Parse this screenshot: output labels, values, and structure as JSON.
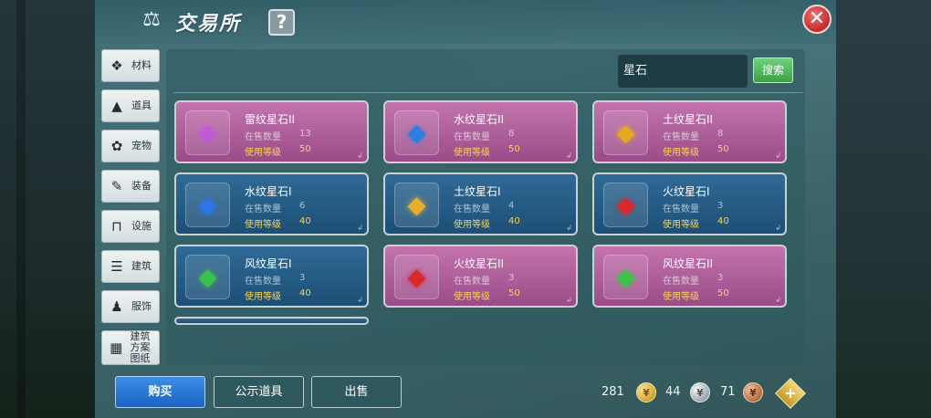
{
  "header": {
    "title": "交易所",
    "help_label": "?",
    "close_label": "✕"
  },
  "sidebar": {
    "items": [
      {
        "label": "材料",
        "icon": "materials-icon",
        "glyph": "❖"
      },
      {
        "label": "道具",
        "icon": "props-icon",
        "glyph": "▲"
      },
      {
        "label": "宠物",
        "icon": "pet-paw-icon",
        "glyph": "✿"
      },
      {
        "label": "装备",
        "icon": "equipment-icon",
        "glyph": "✎"
      },
      {
        "label": "设施",
        "icon": "facility-icon",
        "glyph": "⊓"
      },
      {
        "label": "建筑",
        "icon": "building-icon",
        "glyph": "☰"
      },
      {
        "label": "服饰",
        "icon": "clothing-icon",
        "glyph": "♟"
      },
      {
        "label": "建筑方案图纸",
        "icon": "blueprint-icon",
        "glyph": "▦"
      }
    ]
  },
  "search": {
    "value": "星石",
    "button_label": "搜索"
  },
  "items": [
    {
      "name": "雷纹星石II",
      "stock_label": "在售数量",
      "stock": "13",
      "level_label": "使用等级",
      "level": "50",
      "rarity": "purple",
      "gem": "◆",
      "gem_color": "#c15ad8"
    },
    {
      "name": "水纹星石II",
      "stock_label": "在售数量",
      "stock": "8",
      "level_label": "使用等级",
      "level": "50",
      "rarity": "purple",
      "gem": "◆",
      "gem_color": "#2a7fe0"
    },
    {
      "name": "土纹星石II",
      "stock_label": "在售数量",
      "stock": "8",
      "level_label": "使用等级",
      "level": "50",
      "rarity": "purple",
      "gem": "◆",
      "gem_color": "#e6a820"
    },
    {
      "name": "水纹星石I",
      "stock_label": "在售数量",
      "stock": "6",
      "level_label": "使用等级",
      "level": "40",
      "rarity": "blue",
      "gem": "◆",
      "gem_color": "#2d74e6"
    },
    {
      "name": "土纹星石I",
      "stock_label": "在售数量",
      "stock": "4",
      "level_label": "使用等级",
      "level": "40",
      "rarity": "blue",
      "gem": "◆",
      "gem_color": "#e8b028"
    },
    {
      "name": "火纹星石I",
      "stock_label": "在售数量",
      "stock": "3",
      "level_label": "使用等级",
      "level": "40",
      "rarity": "blue",
      "gem": "◆",
      "gem_color": "#d8282e"
    },
    {
      "name": "风纹星石I",
      "stock_label": "在售数量",
      "stock": "3",
      "level_label": "使用等级",
      "level": "40",
      "rarity": "blue",
      "gem": "◆",
      "gem_color": "#3cc24a"
    },
    {
      "name": "火纹星石II",
      "stock_label": "在售数量",
      "stock": "3",
      "level_label": "使用等级",
      "level": "50",
      "rarity": "purple",
      "gem": "◆",
      "gem_color": "#d8282e"
    },
    {
      "name": "风纹星石II",
      "stock_label": "在售数量",
      "stock": "3",
      "level_label": "使用等级",
      "level": "50",
      "rarity": "purple",
      "gem": "◆",
      "gem_color": "#3cc24a"
    }
  ],
  "footer": {
    "buy_label": "购买",
    "showcase_label": "公示道具",
    "sell_label": "出售",
    "gold": "281",
    "silver": "44",
    "copper": "71"
  }
}
